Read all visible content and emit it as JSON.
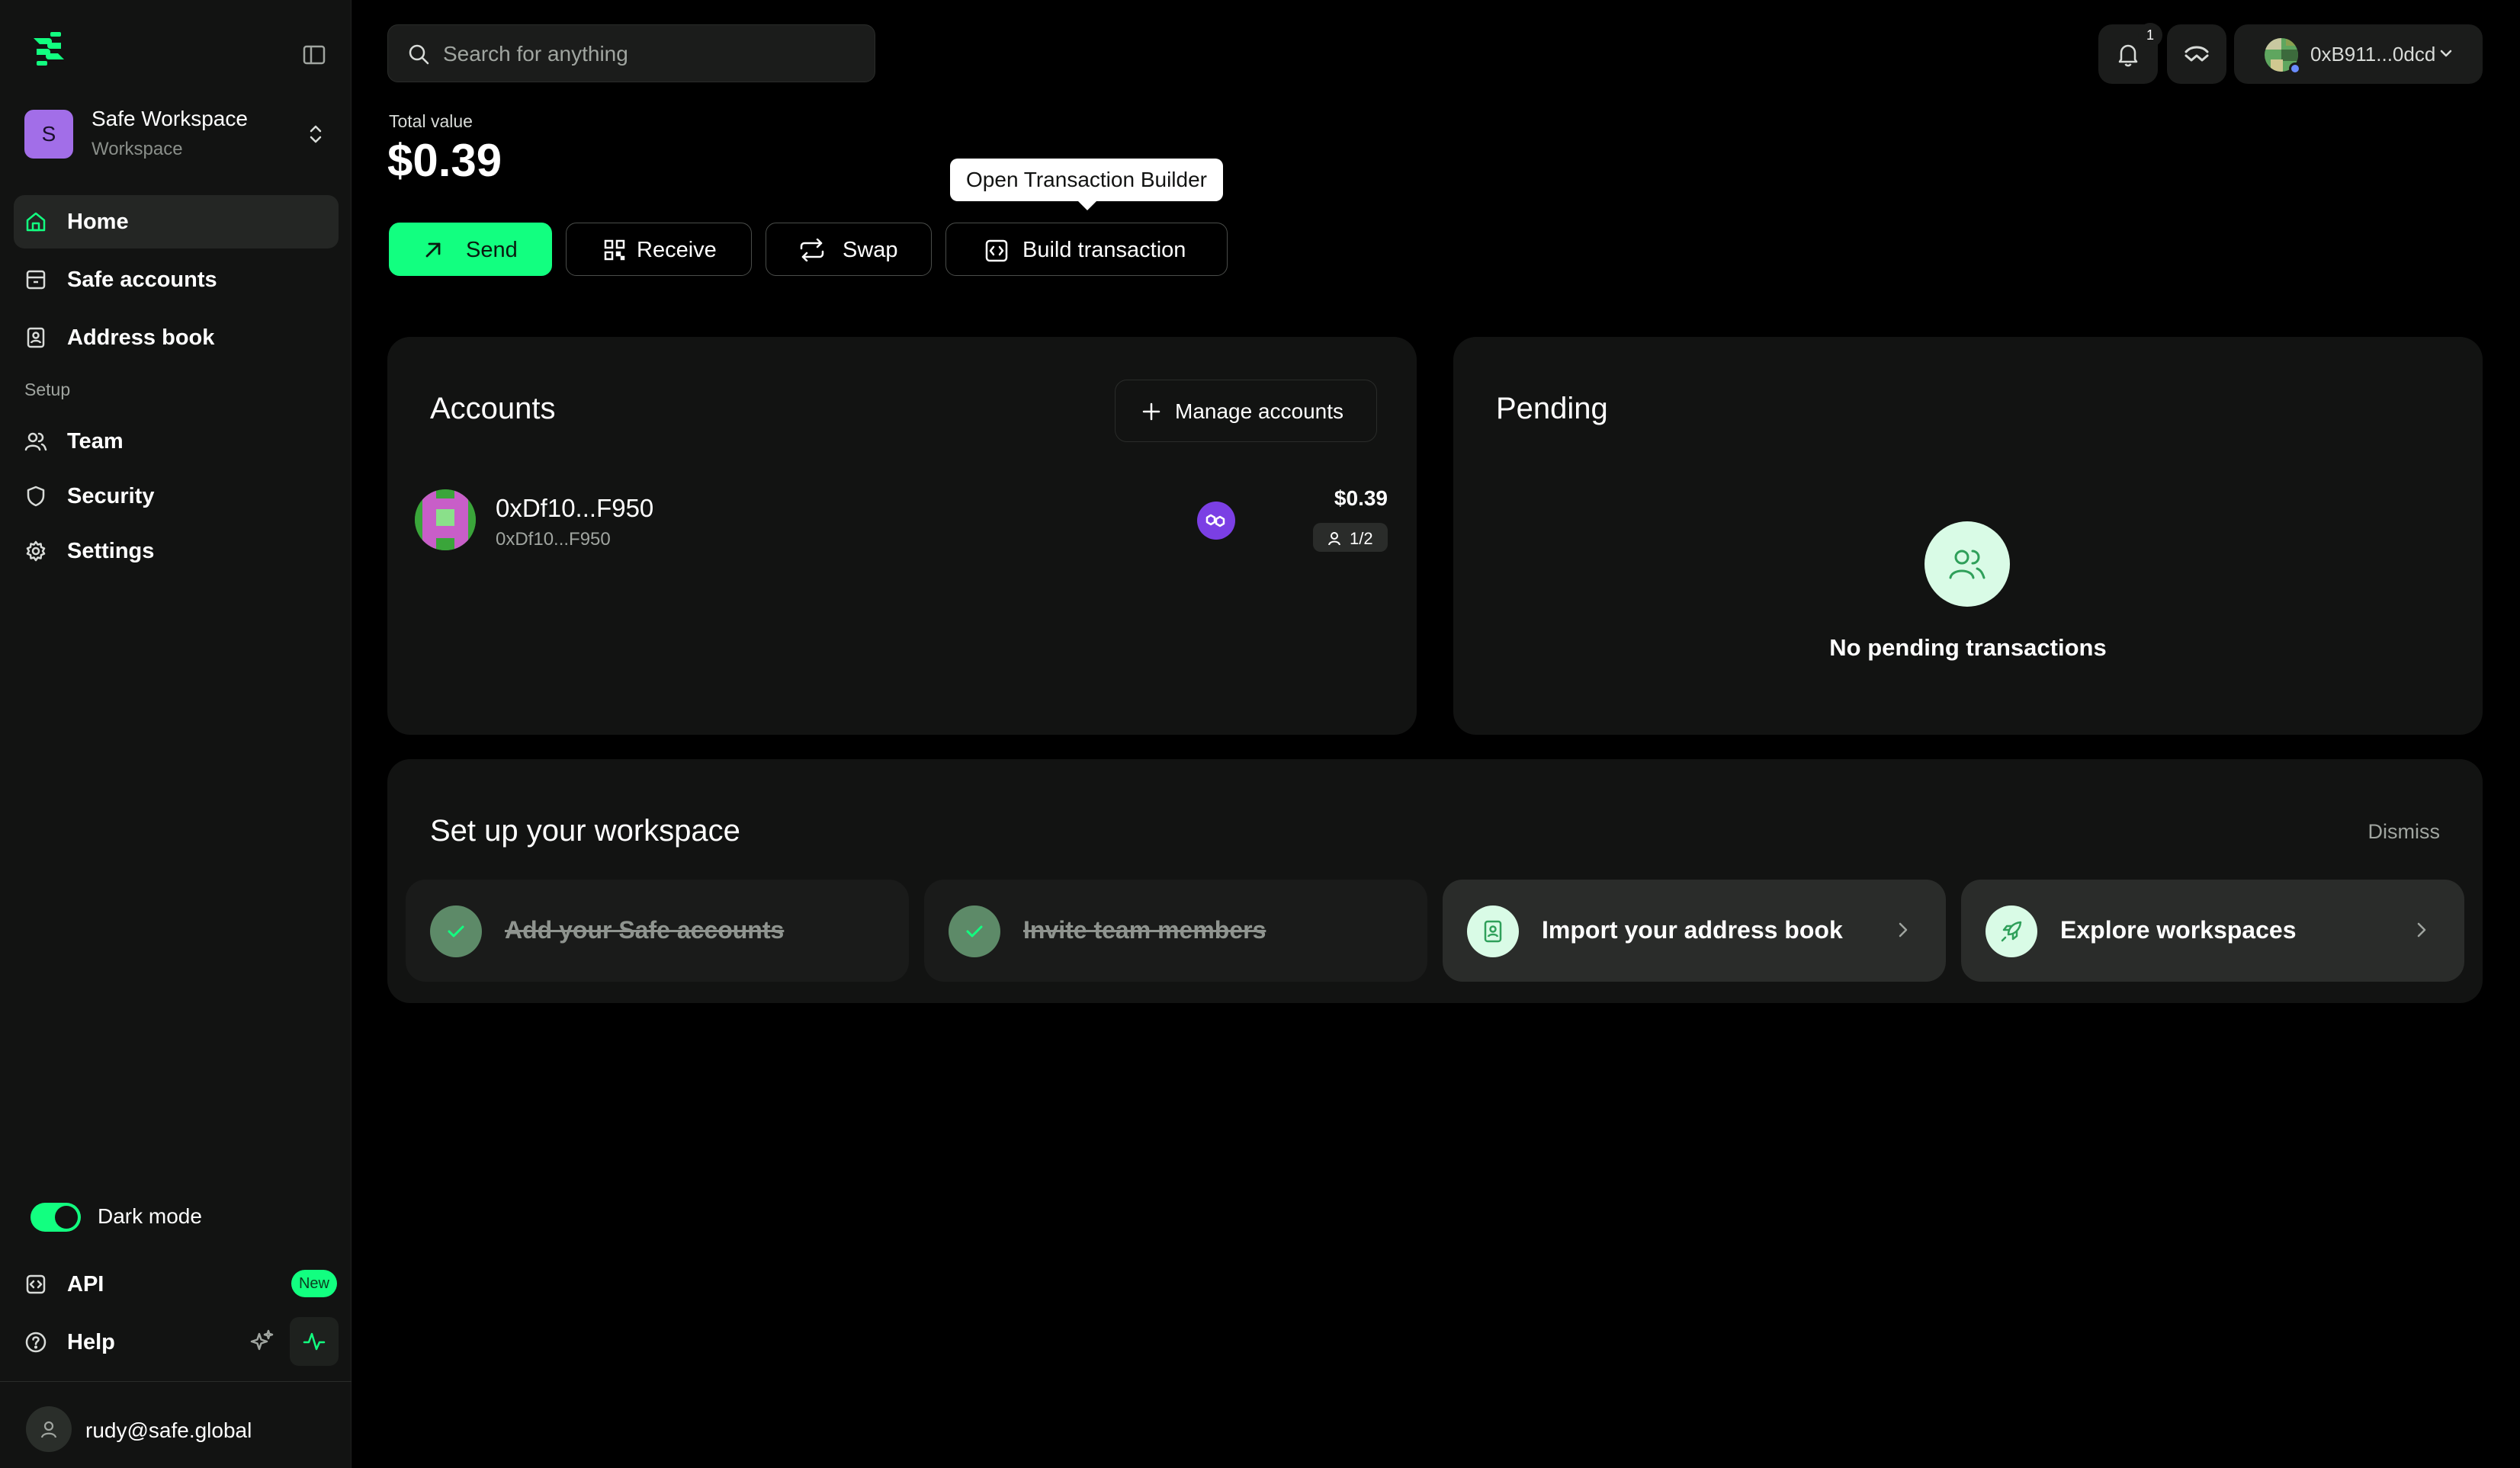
{
  "sidebar": {
    "workspace": {
      "initial": "S",
      "name": "Safe Workspace",
      "type": "Workspace"
    },
    "items": [
      {
        "label": "Home",
        "icon": "home-icon",
        "active": true
      },
      {
        "label": "Safe accounts",
        "icon": "safe-icon"
      },
      {
        "label": "Address book",
        "icon": "address-book-icon"
      }
    ],
    "section_label": "Setup",
    "setup_items": [
      {
        "label": "Team",
        "icon": "team-icon"
      },
      {
        "label": "Security",
        "icon": "shield-icon"
      },
      {
        "label": "Settings",
        "icon": "gear-icon"
      }
    ],
    "dark_mode_label": "Dark mode",
    "api_label": "API",
    "new_badge": "New",
    "help_label": "Help",
    "user_email": "rudy@safe.global"
  },
  "topbar": {
    "search_placeholder": "Search for anything",
    "notification_count": "1",
    "account_address": "0xB911...0dcd"
  },
  "header": {
    "total_label": "Total value",
    "total_value": "$0.39",
    "actions": {
      "send": "Send",
      "receive": "Receive",
      "swap": "Swap",
      "build": "Build transaction"
    },
    "tooltip": "Open Transaction Builder"
  },
  "accounts": {
    "title": "Accounts",
    "manage_label": "Manage accounts",
    "rows": [
      {
        "name": "0xDf10...F950",
        "address": "0xDf10...F950",
        "balance": "$0.39",
        "threshold": "1/2"
      }
    ]
  },
  "pending": {
    "title": "Pending",
    "empty_text": "No pending transactions"
  },
  "setup": {
    "title": "Set up your workspace",
    "dismiss": "Dismiss",
    "steps": [
      {
        "label": "Add your Safe accounts",
        "done": true
      },
      {
        "label": "Invite team members",
        "done": true
      },
      {
        "label": "Import your address book",
        "done": false
      },
      {
        "label": "Explore workspaces",
        "done": false
      }
    ]
  },
  "colors": {
    "accent": "#12ff80",
    "background": "#000000",
    "card": "#121312",
    "workspace_avatar": "#a26ee8"
  }
}
